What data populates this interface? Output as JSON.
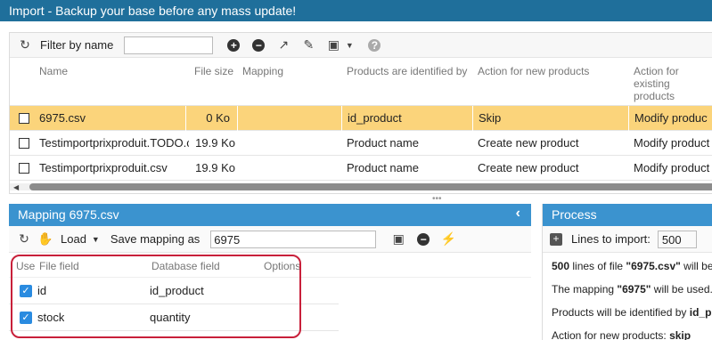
{
  "window_title": "Import - Backup your base before any mass update!",
  "top_toolbar": {
    "filter_label": "Filter by name",
    "filter_value": "",
    "icons": [
      "refresh-icon",
      "add-icon",
      "remove-icon",
      "open-external-icon",
      "edit-icon",
      "save-disk-icon",
      "dropdown-caret-icon",
      "help-icon"
    ]
  },
  "files_grid": {
    "columns": [
      "Name",
      "File size",
      "Mapping",
      "Products are identified by",
      "Action for new products",
      "Action for existing products"
    ],
    "rows": [
      {
        "name": "6975.csv",
        "size": "0 Ko",
        "mapping": "",
        "identified_by": "id_product",
        "action_new": "Skip",
        "action_existing": "Modify product",
        "selected": true
      },
      {
        "name": "Testimportprixproduit.TODO.csv",
        "size": "19.9 Ko",
        "mapping": "",
        "identified_by": "Product name",
        "action_new": "Create new product",
        "action_existing": "Modify product",
        "selected": false
      },
      {
        "name": "Testimportprixproduit.csv",
        "size": "19.9 Ko",
        "mapping": "",
        "identified_by": "Product name",
        "action_new": "Create new product",
        "action_existing": "Modify product",
        "selected": false
      }
    ]
  },
  "mapping_panel": {
    "title": "Mapping 6975.csv",
    "load_label": "Load",
    "save_as_label": "Save mapping as",
    "mapping_name": "6975",
    "columns": [
      "Use",
      "File field",
      "Database field",
      "Options"
    ],
    "rows": [
      {
        "file_field": "id",
        "db_field": "id_product",
        "checked": true
      },
      {
        "file_field": "stock",
        "db_field": "quantity",
        "checked": true
      }
    ]
  },
  "process_panel": {
    "title": "Process",
    "lines_label": "Lines to import:",
    "lines_value": "500",
    "messages": [
      {
        "bold": "500",
        "text": " lines of file ",
        "bold2": "\"6975.csv\"",
        "text2": " will be"
      },
      {
        "bold": "",
        "text": "The mapping ",
        "bold2": "\"6975\"",
        "text2": " will be used."
      },
      {
        "bold": "",
        "text": "Products will be identified by ",
        "bold2": "id_pr",
        "text2": ""
      },
      {
        "bold": "",
        "text": "Action for new products: ",
        "bold2": "skip",
        "text2": ""
      }
    ]
  },
  "colors": {
    "titlebar": "#1f6f9b",
    "panel_header": "#3b93cf",
    "selected_row": "#fbd47b",
    "highlight_border": "#c8203a",
    "checkbox_blue": "#2a8be0"
  }
}
